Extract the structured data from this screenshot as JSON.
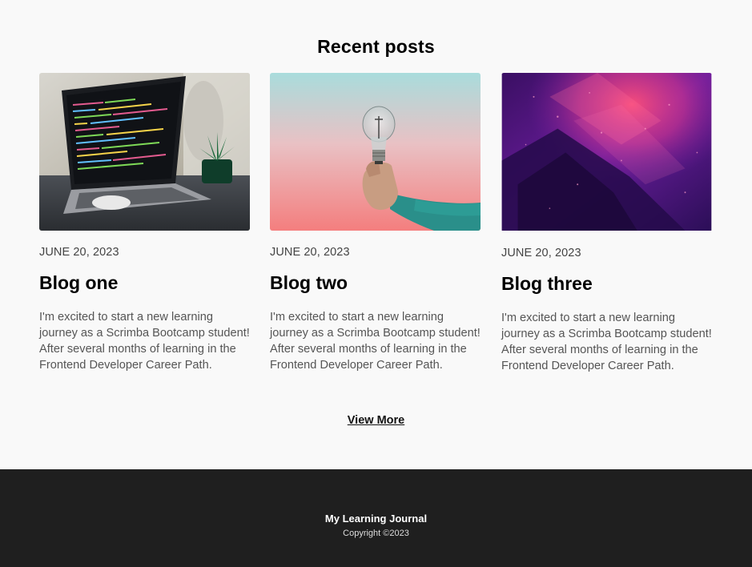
{
  "section": {
    "title": "Recent posts"
  },
  "posts": [
    {
      "date": "JUNE 20, 2023",
      "title": "Blog one",
      "excerpt": "I'm excited to start a new learning journey as a Scrimba Bootcamp student! After several months of learning in the Frontend Developer Career Path.",
      "image": "laptop-code-photo"
    },
    {
      "date": "JUNE 20, 2023",
      "title": "Blog two",
      "excerpt": "I'm excited to start a new learning journey as a Scrimba Bootcamp student! After several months of learning in the Frontend Developer Career Path.",
      "image": "lightbulb-hand-photo"
    },
    {
      "date": "JUNE 20, 2023",
      "title": "Blog three",
      "excerpt": "I'm excited to start a new learning journey as a Scrimba Bootcamp student! After several months of learning in the Frontend Developer Career Path.",
      "image": "purple-abstract-photo"
    }
  ],
  "view_more": {
    "label": "View More"
  },
  "footer": {
    "brand": "My Learning Journal",
    "copyright": "Copyright ©2023",
    "background": "#1f1f1f"
  },
  "colors": {
    "page_bg": "#f9f9f9",
    "text": "#000000",
    "muted": "#555555"
  }
}
